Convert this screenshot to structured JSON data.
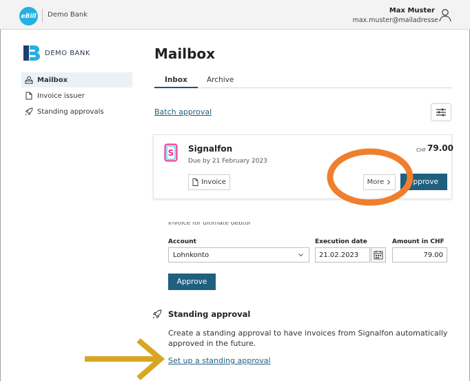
{
  "header": {
    "logo_text": "eBill",
    "bank_name": "Demo Bank",
    "user_name": "Max Muster",
    "user_email": "max.muster@mailadresse"
  },
  "sidebar": {
    "bank_logo_text": "DEMO BANK",
    "items": [
      {
        "label": "Mailbox",
        "icon": "mailbox-icon",
        "active": true
      },
      {
        "label": "Invoice issuer",
        "icon": "document-icon",
        "active": false
      },
      {
        "label": "Standing approvals",
        "icon": "rocket-icon",
        "active": false
      }
    ]
  },
  "main": {
    "title": "Mailbox",
    "tabs": [
      {
        "label": "Inbox",
        "active": true
      },
      {
        "label": "Archive",
        "active": false
      }
    ],
    "batch_approval_link": "Batch approval",
    "filter_icon": "sliders-icon"
  },
  "invoice": {
    "biller": "Signalfon",
    "due": "Due by 21 February 2023",
    "currency": "CHF",
    "amount": "79.00",
    "invoice_button": "Invoice",
    "more_button": "More",
    "approve_button": "Approve",
    "approve_visible": "pprove"
  },
  "form": {
    "cut_text": "Invoice for ultimate debtor",
    "account_label": "Account",
    "account_value": "Lohnkonto",
    "execution_label": "Execution date",
    "execution_value": "21.02.2023",
    "amount_label": "Amount in CHF",
    "amount_value": "79.00",
    "approve_button": "Approve"
  },
  "standing": {
    "title": "Standing approval",
    "description": "Create a standing approval to have invoices from Signalfon automatically approved in the future.",
    "link": "Set up a standing approval"
  },
  "colors": {
    "primary": "#1f5f80",
    "ebill_blue": "#25b0e2",
    "annotation_orange": "#f07f2d",
    "annotation_yellow": "#d9a624",
    "signalfon_pink": "#e8318e"
  }
}
